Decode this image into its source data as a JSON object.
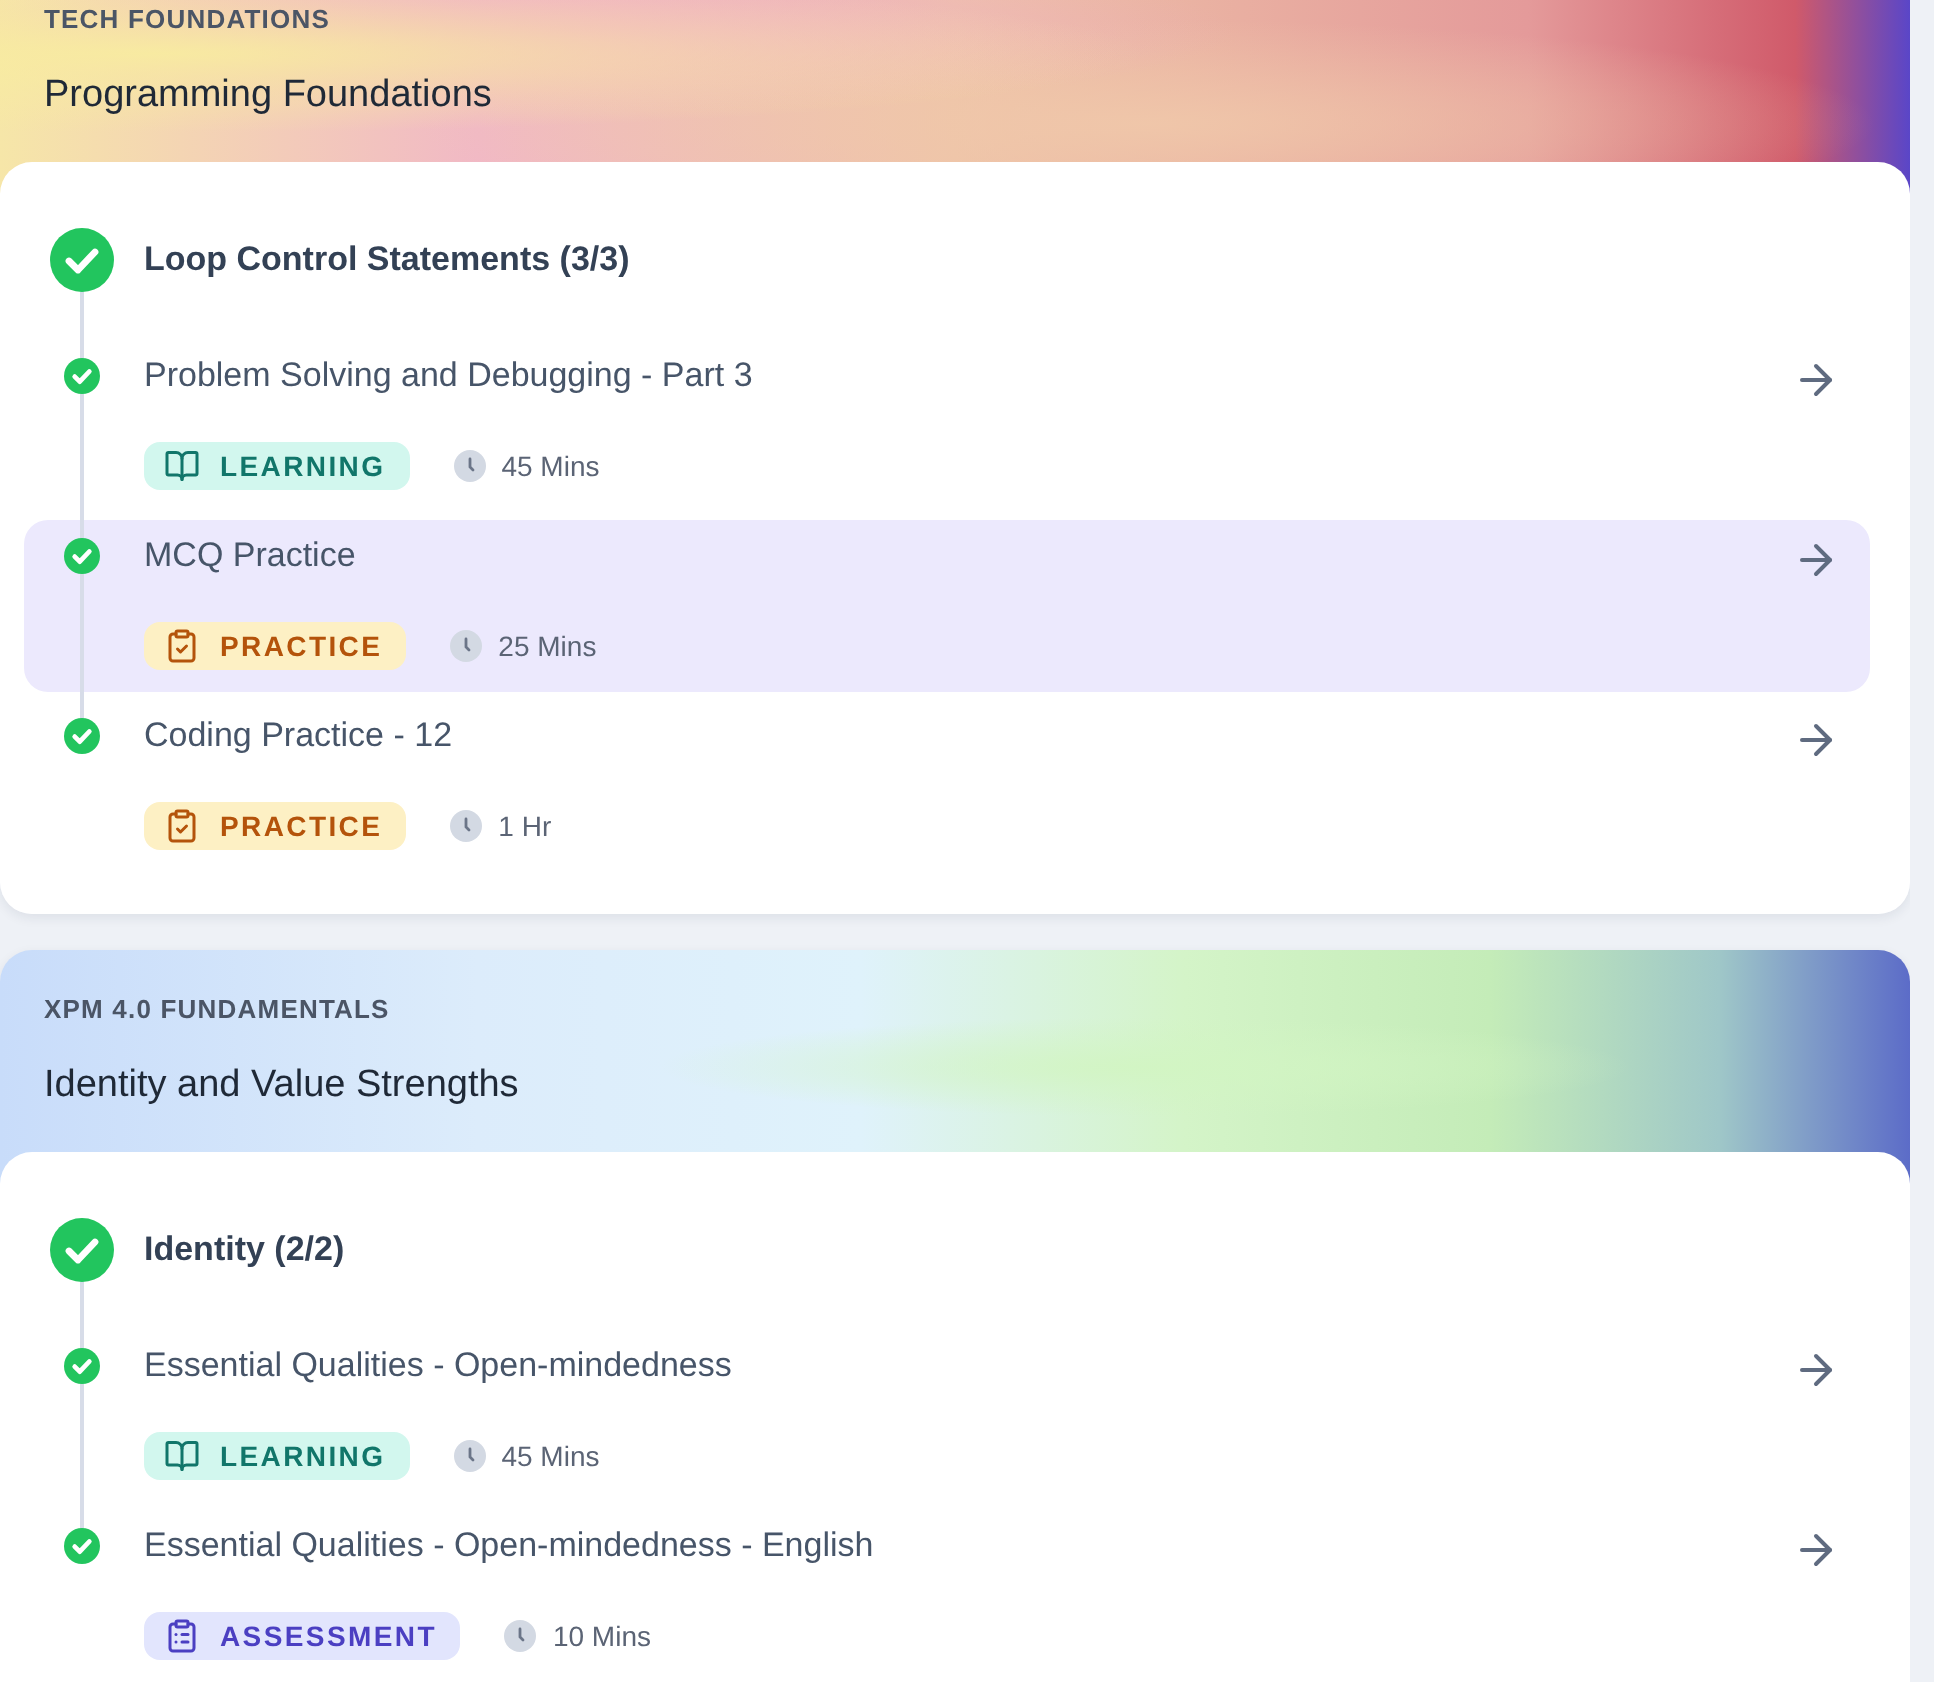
{
  "courses": [
    {
      "category": "TECH FOUNDATIONS",
      "title": "Programming Foundations",
      "module": {
        "title": "Loop Control Statements (3/3)",
        "completed": true
      },
      "items": [
        {
          "title": "Problem Solving and Debugging - Part 3",
          "completed": true,
          "selected": false,
          "tag": {
            "kind": "learning",
            "label": "LEARNING"
          },
          "duration": "45 Mins"
        },
        {
          "title": "MCQ Practice",
          "completed": true,
          "selected": true,
          "tag": {
            "kind": "practice",
            "label": "PRACTICE"
          },
          "duration": "25 Mins"
        },
        {
          "title": "Coding Practice - 12",
          "completed": true,
          "selected": false,
          "tag": {
            "kind": "practice",
            "label": "PRACTICE"
          },
          "duration": "1 Hr"
        }
      ]
    },
    {
      "category": "XPM 4.0 FUNDAMENTALS",
      "title": "Identity and Value Strengths",
      "module": {
        "title": "Identity (2/2)",
        "completed": true
      },
      "items": [
        {
          "title": "Essential Qualities - Open-mindedness",
          "completed": true,
          "selected": false,
          "tag": {
            "kind": "learning",
            "label": "LEARNING"
          },
          "duration": "45 Mins"
        },
        {
          "title": "Essential Qualities - Open-mindedness - English",
          "completed": true,
          "selected": false,
          "tag": {
            "kind": "assessment",
            "label": "ASSESSMENT"
          },
          "duration": "10 Mins"
        }
      ]
    }
  ]
}
